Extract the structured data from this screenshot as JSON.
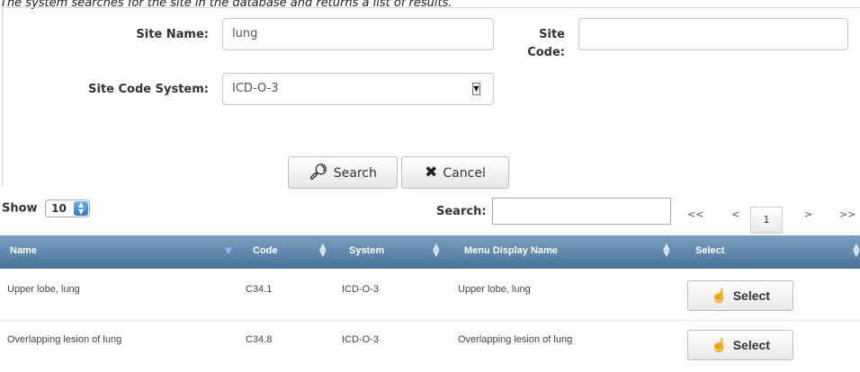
{
  "caption": "The system searches for the site in the database and returns a list of results.",
  "form": {
    "site_name_label": "Site Name:",
    "site_name_value": "lung",
    "site_code_label_line1": "Site",
    "site_code_label_line2": "Code:",
    "site_code_value": "",
    "site_code_system_label": "Site Code System:",
    "site_code_system_value": "ICD-O-3",
    "search_button": "Search",
    "cancel_button": "Cancel"
  },
  "table_controls": {
    "show_label": "Show",
    "page_size": "10",
    "search_label": "Search:",
    "search_value": "",
    "pager": {
      "first": "<<",
      "prev": "<",
      "current": "1",
      "next": ">",
      "last": ">>"
    }
  },
  "table": {
    "columns": [
      "Name",
      "Code",
      "System",
      "Menu Display Name",
      "Select"
    ],
    "rows": [
      {
        "name": "Upper lobe, lung",
        "code": "C34.1",
        "system": "ICD-O-3",
        "display": "Upper lobe, lung",
        "select": "Select"
      },
      {
        "name": "Overlapping lesion of lung",
        "code": "C34.8",
        "system": "ICD-O-3",
        "display": "Overlapping lesion of lung",
        "select": "Select"
      }
    ]
  },
  "icons": {
    "search": "magnifier-icon",
    "cancel": "x-icon",
    "select": "hand-pointer-icon"
  }
}
